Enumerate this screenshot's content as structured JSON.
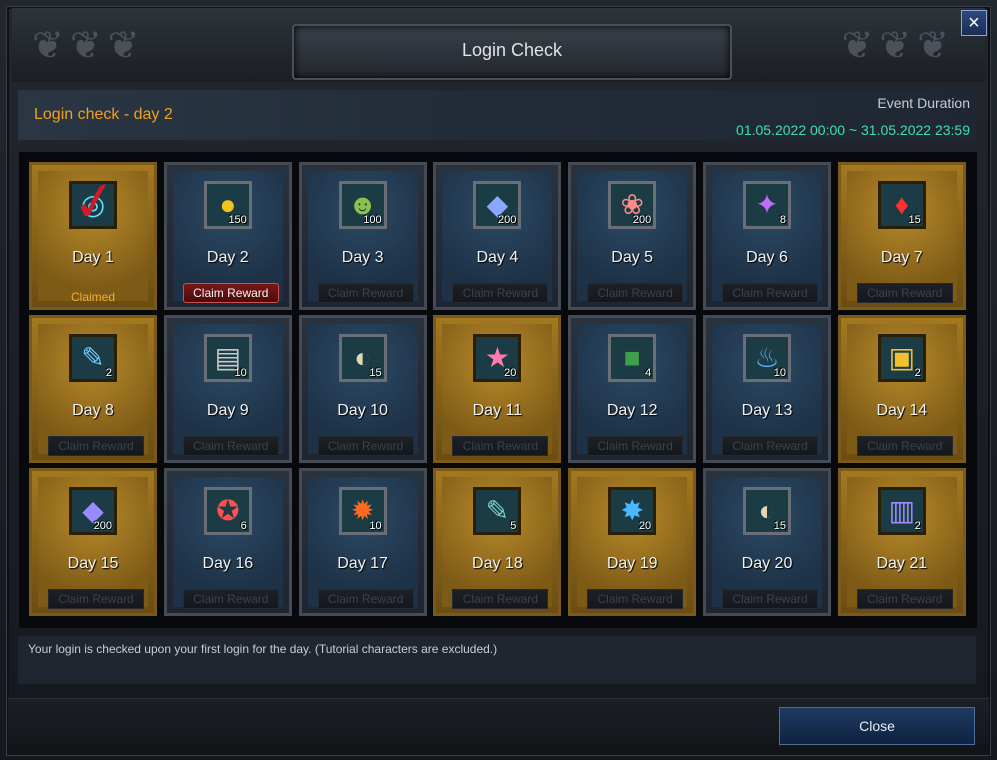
{
  "window": {
    "title": "Login Check",
    "close_icon": "×"
  },
  "header": {
    "status": "Login check - day 2",
    "event_label": "Event Duration",
    "event_dates": "01.05.2022 00:00 ~ 31.05.2022 23:59"
  },
  "colors": {
    "accent_orange": "#f0a020",
    "date_green": "#40e0a8",
    "claim_red": "#7a1717",
    "gold_frame": "#a37820"
  },
  "days": [
    {
      "label": "Day 1",
      "qty": "",
      "icon": "crystal-orb-icon",
      "glyph": "◎",
      "color": "#5ee0ff",
      "gold": true,
      "state": "claimed",
      "status_text": "Claimed"
    },
    {
      "label": "Day 2",
      "qty": "150",
      "icon": "gold-gem-icon",
      "glyph": "●",
      "color": "#f2c020",
      "gold": false,
      "state": "active",
      "button": "Claim Reward"
    },
    {
      "label": "Day 3",
      "qty": "100",
      "icon": "frog-icon",
      "glyph": "☻",
      "color": "#8cc24a",
      "gold": false,
      "state": "locked",
      "button": "Claim Reward"
    },
    {
      "label": "Day 4",
      "qty": "200",
      "icon": "blue-diamond-icon",
      "glyph": "◆",
      "color": "#8aa8ff",
      "gold": false,
      "state": "locked",
      "button": "Claim Reward"
    },
    {
      "label": "Day 5",
      "qty": "200",
      "icon": "pink-coral-icon",
      "glyph": "❀",
      "color": "#ff8a8a",
      "gold": false,
      "state": "locked",
      "button": "Claim Reward"
    },
    {
      "label": "Day 6",
      "qty": "8",
      "icon": "rainbow-gem-icon",
      "glyph": "✦",
      "color": "#c36bff",
      "gold": false,
      "state": "locked",
      "button": "Claim Reward"
    },
    {
      "label": "Day 7",
      "qty": "15",
      "icon": "red-crystal-icon",
      "glyph": "♦",
      "color": "#ff3030",
      "gold": true,
      "state": "locked",
      "button": "Claim Reward"
    },
    {
      "label": "Day 8",
      "qty": "2",
      "icon": "blue-scroll-icon",
      "glyph": "✎",
      "color": "#6ec8ff",
      "gold": true,
      "state": "locked",
      "button": "Claim Reward"
    },
    {
      "label": "Day 9",
      "qty": "10",
      "icon": "map-scroll-icon",
      "glyph": "▤",
      "color": "#c8c8c8",
      "gold": false,
      "state": "locked",
      "button": "Claim Reward"
    },
    {
      "label": "Day 10",
      "qty": "15",
      "icon": "rune-stone-icon",
      "glyph": "◐",
      "color": "#e0d8b0",
      "gold": false,
      "state": "locked",
      "button": "Claim Reward"
    },
    {
      "label": "Day 11",
      "qty": "20",
      "icon": "pink-star-icon",
      "glyph": "★",
      "color": "#ff7ab0",
      "gold": true,
      "state": "locked",
      "button": "Claim Reward"
    },
    {
      "label": "Day 12",
      "qty": "4",
      "icon": "green-giftbox-icon",
      "glyph": "■",
      "color": "#3ea04a",
      "gold": false,
      "state": "locked",
      "button": "Claim Reward"
    },
    {
      "label": "Day 13",
      "qty": "10",
      "icon": "potion-bag-icon",
      "glyph": "♨",
      "color": "#5ab0ff",
      "gold": false,
      "state": "locked",
      "button": "Claim Reward"
    },
    {
      "label": "Day 14",
      "qty": "2",
      "icon": "treasure-chest-icon",
      "glyph": "▣",
      "color": "#f0c030",
      "gold": true,
      "state": "locked",
      "button": "Claim Reward"
    },
    {
      "label": "Day 15",
      "qty": "200",
      "icon": "violet-diamond-icon",
      "glyph": "◆",
      "color": "#9a8aff",
      "gold": true,
      "state": "locked",
      "button": "Claim Reward"
    },
    {
      "label": "Day 16",
      "qty": "6",
      "icon": "ruby-amulet-icon",
      "glyph": "✪",
      "color": "#ff5050",
      "gold": false,
      "state": "locked",
      "button": "Claim Reward"
    },
    {
      "label": "Day 17",
      "qty": "10",
      "icon": "fire-crystal-icon",
      "glyph": "✹",
      "color": "#ff6a20",
      "gold": false,
      "state": "locked",
      "button": "Claim Reward"
    },
    {
      "label": "Day 18",
      "qty": "5",
      "icon": "scroll-seal-icon",
      "glyph": "✎",
      "color": "#7ad0d0",
      "gold": true,
      "state": "locked",
      "button": "Claim Reward"
    },
    {
      "label": "Day 19",
      "qty": "20",
      "icon": "blue-ore-icon",
      "glyph": "✸",
      "color": "#4ab8ff",
      "gold": true,
      "state": "locked",
      "button": "Claim Reward"
    },
    {
      "label": "Day 20",
      "qty": "15",
      "icon": "rune-stone-icon",
      "glyph": "◐",
      "color": "#e0d8b0",
      "gold": false,
      "state": "locked",
      "button": "Claim Reward"
    },
    {
      "label": "Day 21",
      "qty": "2",
      "icon": "card-pack-icon",
      "glyph": "▥",
      "color": "#a08aff",
      "gold": true,
      "state": "locked",
      "button": "Claim Reward"
    }
  ],
  "footer": {
    "note": "Your login is checked upon your first login for the day. (Tutorial characters are excluded.)"
  },
  "actions": {
    "close": "Close"
  }
}
